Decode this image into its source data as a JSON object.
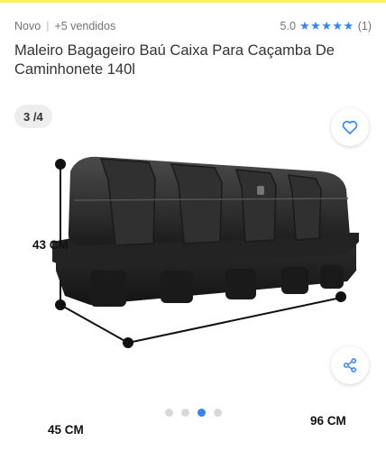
{
  "product": {
    "condition": "Novo",
    "separator": "|",
    "sold": "+5 vendidos",
    "rating": "5.0",
    "stars": "★★★★★",
    "reviews": "(1)",
    "title": "Maleiro Bagageiro Baú Caixa Para Caçamba De Caminhonete 140l"
  },
  "gallery": {
    "counter": "3 /4",
    "dims": {
      "height": "43 CM",
      "depth": "45 CM",
      "width": "96 CM"
    },
    "total_images": 4,
    "active_index": 3
  },
  "colors": {
    "accent": "#3483fa",
    "star": "#3483fa",
    "brand_yellow": "#fff159"
  },
  "icons": {
    "favorite": "heart-icon",
    "share": "share-icon"
  }
}
